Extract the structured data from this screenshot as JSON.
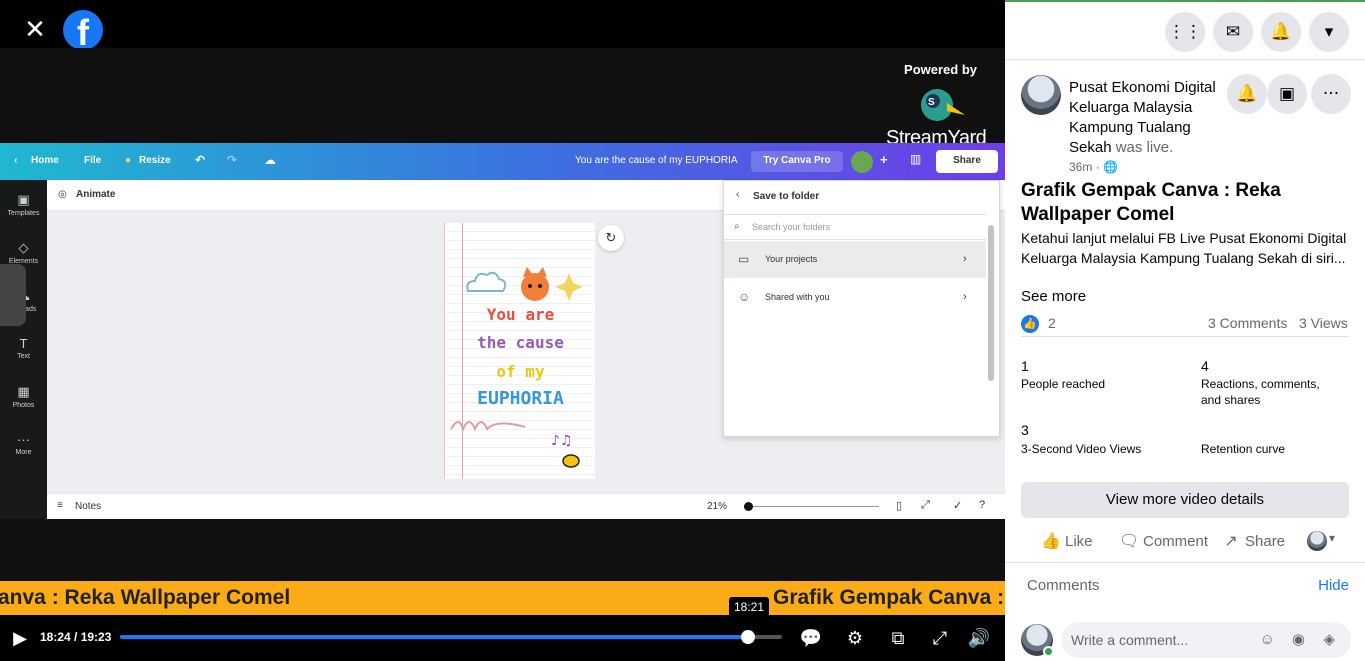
{
  "video": {
    "powered_by": "Powered by",
    "streamyard": "StreamYard",
    "ticker_left": "anva : Reka Wallpaper Comel",
    "ticker_right": "Grafik Gempak Canva : R",
    "time": "18:24 / 19:23",
    "hover_time": "18:21",
    "progress_fraction": 0.948
  },
  "canva": {
    "home": "Home",
    "file": "File",
    "resize": "Resize",
    "doc_title": "You are the cause of my EUPHORIA",
    "try_pro": "Try Canva Pro",
    "share": "Share",
    "animate": "Animate",
    "side": [
      "Templates",
      "Elements",
      "Uploads",
      "Text",
      "Photos",
      "More"
    ],
    "art_lines": [
      "You are",
      "the cause",
      "of my",
      "EUPHORIA"
    ],
    "save_to_folder": "Save to folder",
    "search_placeholder": "Search your folders",
    "your_projects": "Your projects",
    "shared_with_you": "Shared with you",
    "notes": "Notes",
    "zoom": "21%"
  },
  "post": {
    "page_name": "Pusat Ekonomi Digital Keluarga Malaysia Kampung Tualang Sekah",
    "was_live": "was live.",
    "time_ago": "36m ·",
    "title": "Grafik Gempak Canva : Reka Wallpaper Comel",
    "description": "Ketahui lanjut melalui FB Live Pusat Ekonomi Digital Keluarga Malaysia Kampung Tualang Sekah di siri...",
    "see_more": "See more",
    "reactions": "2",
    "comments_count": "3 Comments",
    "views_count": "3 Views",
    "insights": [
      {
        "num": "1",
        "label": "People reached"
      },
      {
        "num": "4",
        "label": "Reactions, comments, and shares"
      },
      {
        "num": "3",
        "label": "3-Second Video Views"
      },
      {
        "num": "",
        "label": "Retention curve"
      }
    ],
    "view_more": "View more video details",
    "like": "Like",
    "comment": "Comment",
    "share": "Share",
    "comments_label": "Comments",
    "hide": "Hide",
    "write_comment": "Write a comment..."
  }
}
